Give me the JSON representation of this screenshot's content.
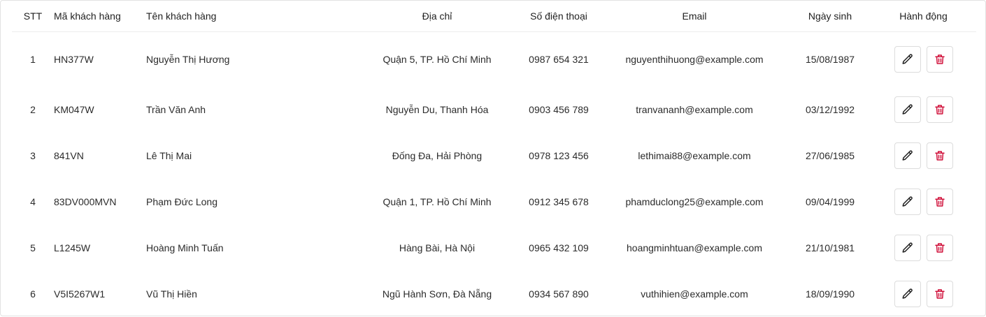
{
  "table": {
    "columns": {
      "stt": "STT",
      "code": "Mã khách hàng",
      "name": "Tên khách hàng",
      "address": "Địa chỉ",
      "phone": "Số điện thoại",
      "email": "Email",
      "dob": "Ngày sinh",
      "actions": "Hành động"
    },
    "rows": [
      {
        "stt": "1",
        "code": "HN377W",
        "name": "Nguyễn Thị Hương",
        "address": "Quận 5, TP. Hồ Chí Minh",
        "phone": "0987 654 321",
        "email": "nguyenthihuong@example.com",
        "dob": "15/08/1987"
      },
      {
        "stt": "2",
        "code": "KM047W",
        "name": "Trần Văn Anh",
        "address": "Nguyễn Du, Thanh Hóa",
        "phone": "0903 456 789",
        "email": "tranvananh@example.com",
        "dob": "03/12/1992"
      },
      {
        "stt": "3",
        "code": "841VN",
        "name": "Lê Thị Mai",
        "address": "Đống Đa, Hải Phòng",
        "phone": "0978 123 456",
        "email": "lethimai88@example.com",
        "dob": "27/06/1985"
      },
      {
        "stt": "4",
        "code": "83DV000MVN",
        "name": "Phạm Đức Long",
        "address": "Quận 1, TP. Hồ Chí Minh",
        "phone": "0912 345 678",
        "email": "phamduclong25@example.com",
        "dob": "09/04/1999"
      },
      {
        "stt": "5",
        "code": "L1245W",
        "name": "Hoàng Minh Tuấn",
        "address": "Hàng Bài, Hà Nội",
        "phone": "0965 432 109",
        "email": "hoangminhtuan@example.com",
        "dob": "21/10/1981"
      },
      {
        "stt": "6",
        "code": "V5I5267W1",
        "name": "Vũ Thị Hiền",
        "address": "Ngũ Hành Sơn, Đà Nẵng",
        "phone": "0934 567 890",
        "email": "vuthihien@example.com",
        "dob": "18/09/1990"
      }
    ]
  },
  "icons": {
    "edit": "pencil-icon",
    "delete": "trash-icon"
  },
  "colors": {
    "delete_icon": "#d0103a",
    "edit_icon": "#1f1f1f",
    "border": "#e2e2e2"
  }
}
